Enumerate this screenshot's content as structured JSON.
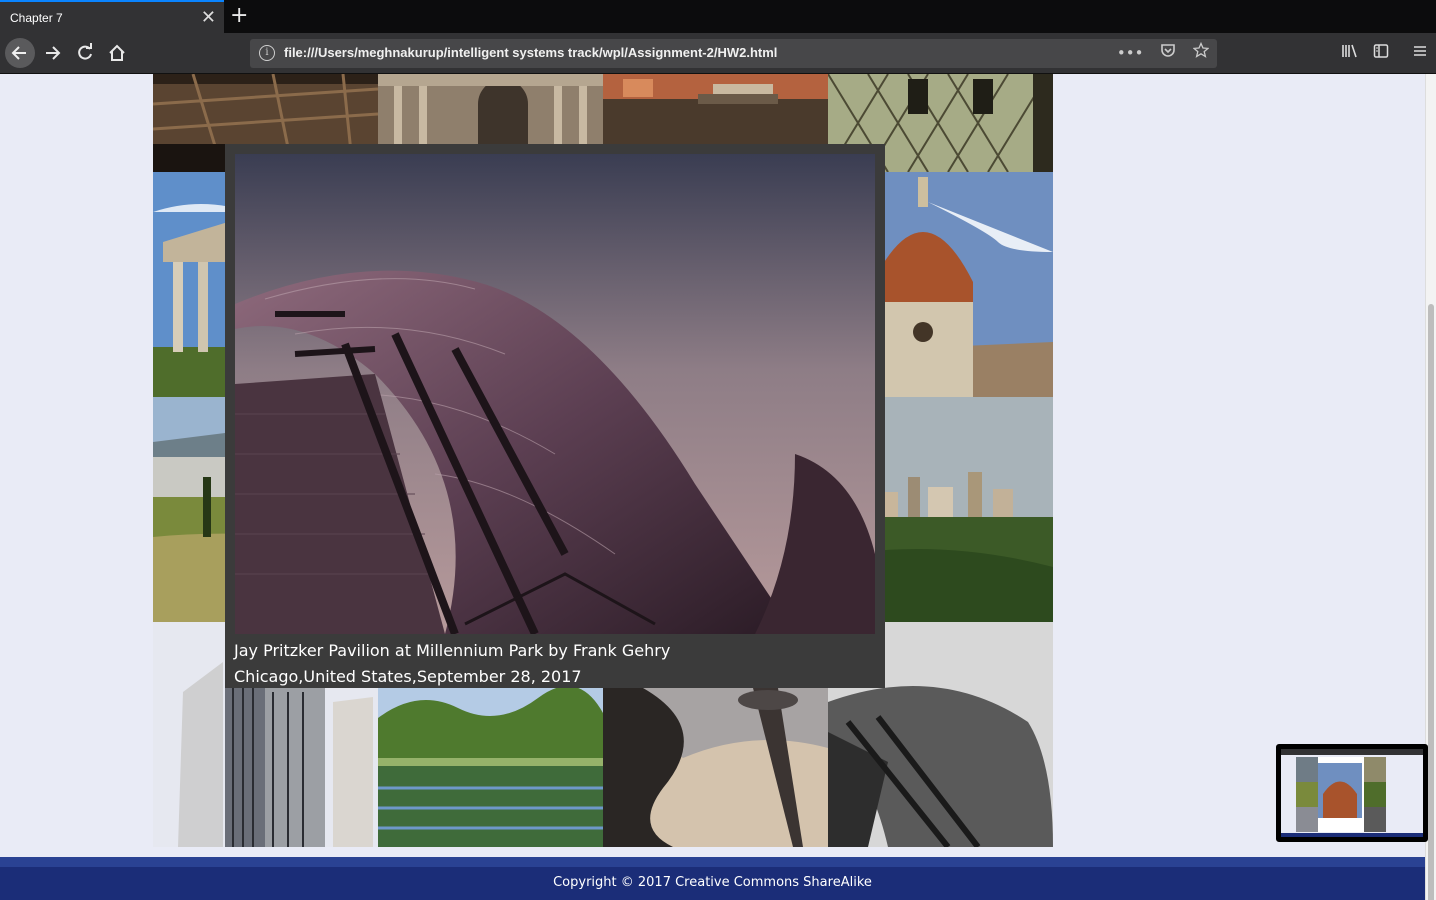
{
  "browser": {
    "tab_title": "Chapter 7",
    "tab_close": "✕",
    "new_tab": "+",
    "url": "file:///Users/meghnakurup/intelligent systems track/wpl/Assignment-2/HW2.html",
    "more_label": "•••"
  },
  "lightbox": {
    "caption_title": "Jay Pritzker Pavilion at Millennium Park by Frank Gehry",
    "caption_detail": "Chicago,United States,September 28, 2017"
  },
  "footer": {
    "copyright": "Copyright © 2017 Creative Commons ShareAlike"
  },
  "colors": {
    "accent": "#0a84ff",
    "footer": "#1b2d78",
    "page_bg": "#e9ebf6"
  }
}
